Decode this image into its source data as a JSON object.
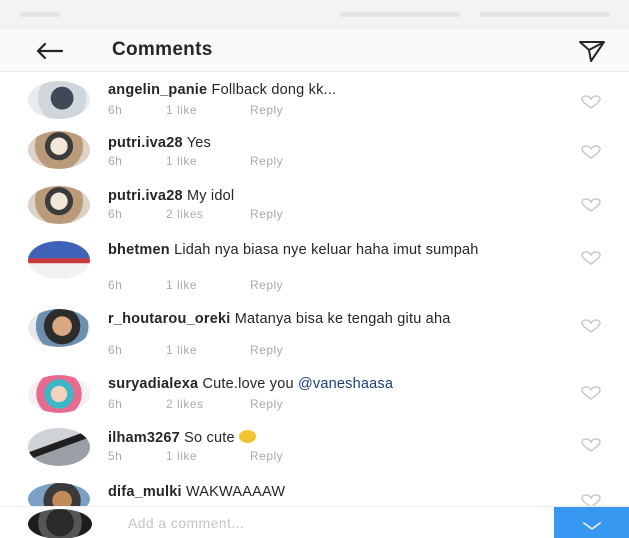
{
  "header": {
    "title": "Comments",
    "back_icon": "back-arrow-icon",
    "send_icon": "paper-plane-icon"
  },
  "comments": [
    {
      "username": "angelin_panie",
      "text": "Follback dong kk...",
      "time": "6h",
      "likes": "1 like",
      "reply": "Reply"
    },
    {
      "username": "putri.iva28",
      "text": "Yes",
      "time": "6h",
      "likes": "1 like",
      "reply": "Reply"
    },
    {
      "username": "putri.iva28",
      "text": "My idol",
      "time": "6h",
      "likes": "2 likes",
      "reply": "Reply"
    },
    {
      "username": "bhetmen",
      "text": "Lidah nya biasa nye keluar haha imut sumpah",
      "time": "6h",
      "likes": "1 like",
      "reply": "Reply"
    },
    {
      "username": "r_houtarou_oreki",
      "text": "Matanya bisa ke tengah gitu aha",
      "time": "6h",
      "likes": "1 like",
      "reply": "Reply"
    },
    {
      "username": "suryadialexa",
      "text": "Cute.love you",
      "mention": "@vaneshaasa",
      "time": "6h",
      "likes": "2 likes",
      "reply": "Reply"
    },
    {
      "username": "ilham3267",
      "text": "So cute",
      "time": "5h",
      "likes": "1 like",
      "reply": "Reply"
    },
    {
      "username": "difa_mulki",
      "text": "WAKWAAAAW"
    }
  ],
  "compose": {
    "placeholder": "Add a comment..."
  },
  "colors": {
    "header_bg": "#fafafa",
    "meta_text": "#aaaaaa",
    "mention": "#1a3f7a",
    "post_button": "#3897f0"
  }
}
